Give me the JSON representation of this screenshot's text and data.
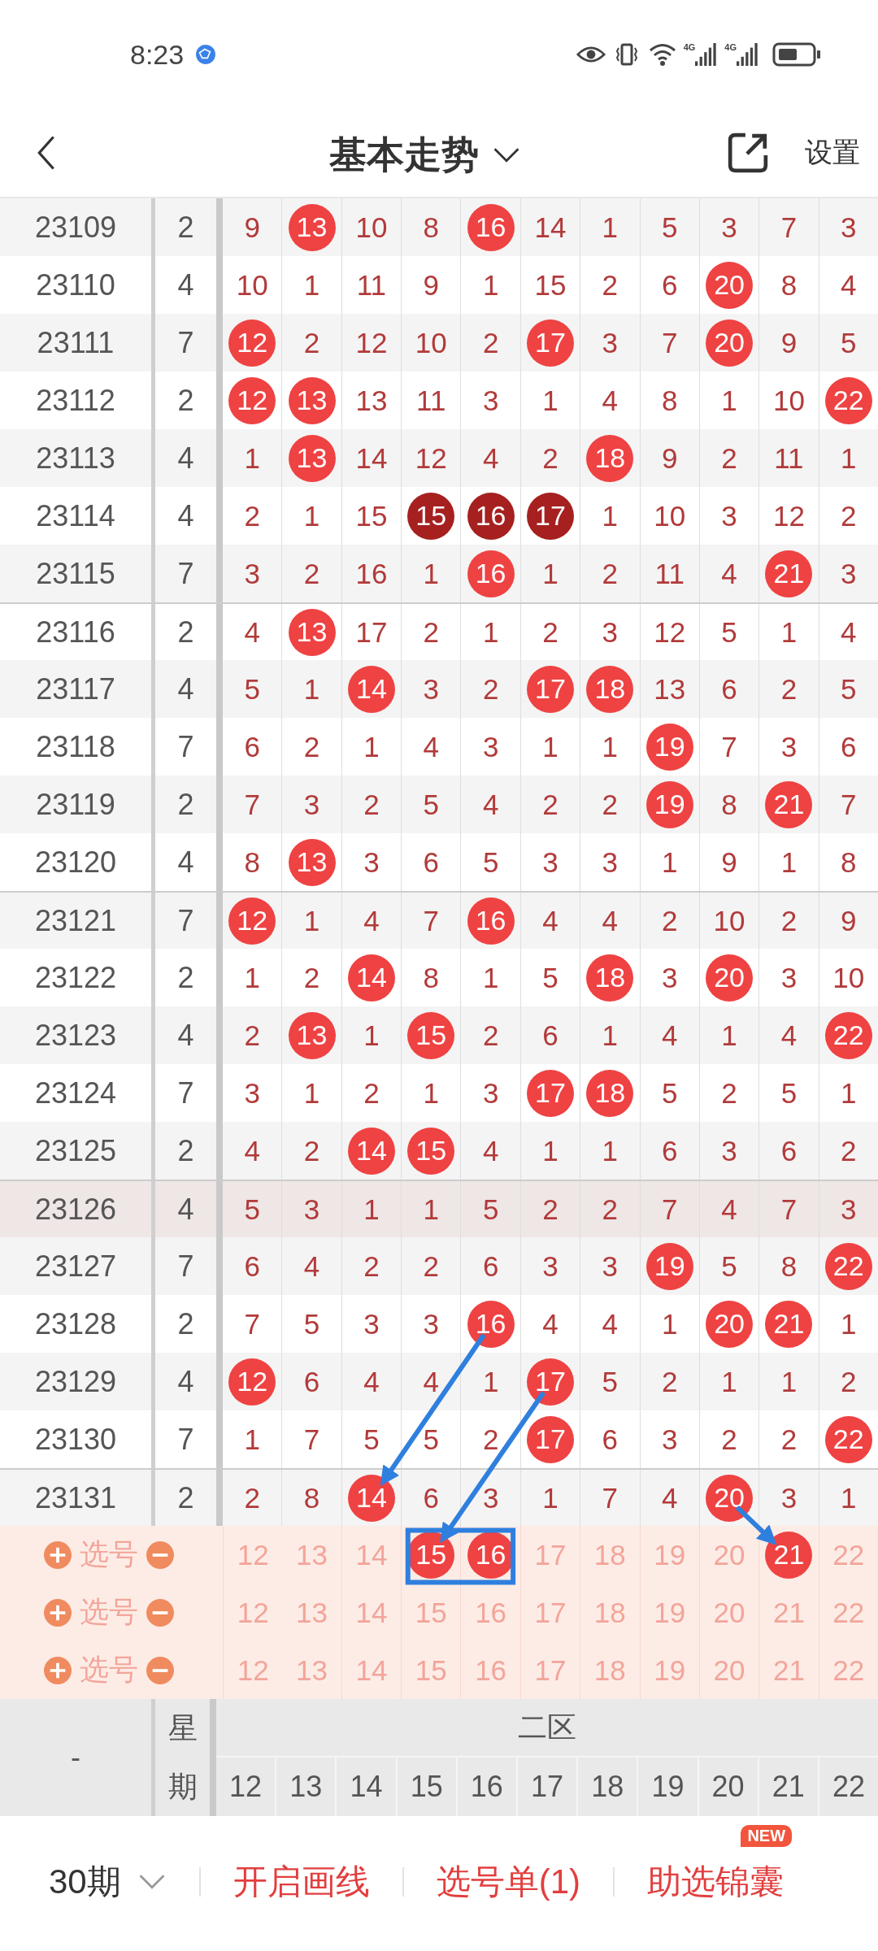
{
  "status_bar": {
    "time": "8:23",
    "signals": [
      {
        "label": "4G"
      },
      {
        "label": "4G"
      }
    ]
  },
  "header": {
    "title": "基本走势",
    "settings": "设置"
  },
  "rows": [
    {
      "period": "23109",
      "weekday": "2",
      "highlighted": false,
      "cells": [
        {
          "value": "9",
          "kind": "plain"
        },
        {
          "value": "13",
          "kind": "ball"
        },
        {
          "value": "10",
          "kind": "plain"
        },
        {
          "value": "8",
          "kind": "plain"
        },
        {
          "value": "16",
          "kind": "ball"
        },
        {
          "value": "14",
          "kind": "plain"
        },
        {
          "value": "1",
          "kind": "plain"
        },
        {
          "value": "5",
          "kind": "plain"
        },
        {
          "value": "3",
          "kind": "plain"
        },
        {
          "value": "7",
          "kind": "plain"
        },
        {
          "value": "3",
          "kind": "plain"
        }
      ]
    },
    {
      "period": "23110",
      "weekday": "4",
      "highlighted": false,
      "cells": [
        {
          "value": "10",
          "kind": "plain"
        },
        {
          "value": "1",
          "kind": "plain"
        },
        {
          "value": "11",
          "kind": "plain"
        },
        {
          "value": "9",
          "kind": "plain"
        },
        {
          "value": "1",
          "kind": "plain"
        },
        {
          "value": "15",
          "kind": "plain"
        },
        {
          "value": "2",
          "kind": "plain"
        },
        {
          "value": "6",
          "kind": "plain"
        },
        {
          "value": "20",
          "kind": "ball"
        },
        {
          "value": "8",
          "kind": "plain"
        },
        {
          "value": "4",
          "kind": "plain"
        }
      ]
    },
    {
      "period": "23111",
      "weekday": "7",
      "highlighted": false,
      "cells": [
        {
          "value": "12",
          "kind": "ball"
        },
        {
          "value": "2",
          "kind": "plain"
        },
        {
          "value": "12",
          "kind": "plain"
        },
        {
          "value": "10",
          "kind": "plain"
        },
        {
          "value": "2",
          "kind": "plain"
        },
        {
          "value": "17",
          "kind": "ball"
        },
        {
          "value": "3",
          "kind": "plain"
        },
        {
          "value": "7",
          "kind": "plain"
        },
        {
          "value": "20",
          "kind": "ball"
        },
        {
          "value": "9",
          "kind": "plain"
        },
        {
          "value": "5",
          "kind": "plain"
        }
      ]
    },
    {
      "period": "23112",
      "weekday": "2",
      "highlighted": false,
      "cells": [
        {
          "value": "12",
          "kind": "ball"
        },
        {
          "value": "13",
          "kind": "ball"
        },
        {
          "value": "13",
          "kind": "plain"
        },
        {
          "value": "11",
          "kind": "plain"
        },
        {
          "value": "3",
          "kind": "plain"
        },
        {
          "value": "1",
          "kind": "plain"
        },
        {
          "value": "4",
          "kind": "plain"
        },
        {
          "value": "8",
          "kind": "plain"
        },
        {
          "value": "1",
          "kind": "plain"
        },
        {
          "value": "10",
          "kind": "plain"
        },
        {
          "value": "22",
          "kind": "ball"
        }
      ]
    },
    {
      "period": "23113",
      "weekday": "4",
      "highlighted": false,
      "cells": [
        {
          "value": "1",
          "kind": "plain"
        },
        {
          "value": "13",
          "kind": "ball"
        },
        {
          "value": "14",
          "kind": "plain"
        },
        {
          "value": "12",
          "kind": "plain"
        },
        {
          "value": "4",
          "kind": "plain"
        },
        {
          "value": "2",
          "kind": "plain"
        },
        {
          "value": "18",
          "kind": "ball"
        },
        {
          "value": "9",
          "kind": "plain"
        },
        {
          "value": "2",
          "kind": "plain"
        },
        {
          "value": "11",
          "kind": "plain"
        },
        {
          "value": "1",
          "kind": "plain"
        }
      ]
    },
    {
      "period": "23114",
      "weekday": "4",
      "highlighted": false,
      "cells": [
        {
          "value": "2",
          "kind": "plain"
        },
        {
          "value": "1",
          "kind": "plain"
        },
        {
          "value": "15",
          "kind": "plain"
        },
        {
          "value": "15",
          "kind": "dark"
        },
        {
          "value": "16",
          "kind": "dark"
        },
        {
          "value": "17",
          "kind": "dark"
        },
        {
          "value": "1",
          "kind": "plain"
        },
        {
          "value": "10",
          "kind": "plain"
        },
        {
          "value": "3",
          "kind": "plain"
        },
        {
          "value": "12",
          "kind": "plain"
        },
        {
          "value": "2",
          "kind": "plain"
        }
      ]
    },
    {
      "period": "23115",
      "weekday": "7",
      "highlighted": false,
      "cells": [
        {
          "value": "3",
          "kind": "plain"
        },
        {
          "value": "2",
          "kind": "plain"
        },
        {
          "value": "16",
          "kind": "plain"
        },
        {
          "value": "1",
          "kind": "plain"
        },
        {
          "value": "16",
          "kind": "ball"
        },
        {
          "value": "1",
          "kind": "plain"
        },
        {
          "value": "2",
          "kind": "plain"
        },
        {
          "value": "11",
          "kind": "plain"
        },
        {
          "value": "4",
          "kind": "plain"
        },
        {
          "value": "21",
          "kind": "ball"
        },
        {
          "value": "3",
          "kind": "plain"
        }
      ]
    },
    {
      "period": "23116",
      "weekday": "2",
      "highlighted": false,
      "cells": [
        {
          "value": "4",
          "kind": "plain"
        },
        {
          "value": "13",
          "kind": "ball"
        },
        {
          "value": "17",
          "kind": "plain"
        },
        {
          "value": "2",
          "kind": "plain"
        },
        {
          "value": "1",
          "kind": "plain"
        },
        {
          "value": "2",
          "kind": "plain"
        },
        {
          "value": "3",
          "kind": "plain"
        },
        {
          "value": "12",
          "kind": "plain"
        },
        {
          "value": "5",
          "kind": "plain"
        },
        {
          "value": "1",
          "kind": "plain"
        },
        {
          "value": "4",
          "kind": "plain"
        }
      ]
    },
    {
      "period": "23117",
      "weekday": "4",
      "highlighted": false,
      "cells": [
        {
          "value": "5",
          "kind": "plain"
        },
        {
          "value": "1",
          "kind": "plain"
        },
        {
          "value": "14",
          "kind": "ball"
        },
        {
          "value": "3",
          "kind": "plain"
        },
        {
          "value": "2",
          "kind": "plain"
        },
        {
          "value": "17",
          "kind": "ball"
        },
        {
          "value": "18",
          "kind": "ball"
        },
        {
          "value": "13",
          "kind": "plain"
        },
        {
          "value": "6",
          "kind": "plain"
        },
        {
          "value": "2",
          "kind": "plain"
        },
        {
          "value": "5",
          "kind": "plain"
        }
      ]
    },
    {
      "period": "23118",
      "weekday": "7",
      "highlighted": false,
      "cells": [
        {
          "value": "6",
          "kind": "plain"
        },
        {
          "value": "2",
          "kind": "plain"
        },
        {
          "value": "1",
          "kind": "plain"
        },
        {
          "value": "4",
          "kind": "plain"
        },
        {
          "value": "3",
          "kind": "plain"
        },
        {
          "value": "1",
          "kind": "plain"
        },
        {
          "value": "1",
          "kind": "plain"
        },
        {
          "value": "19",
          "kind": "ball"
        },
        {
          "value": "7",
          "kind": "plain"
        },
        {
          "value": "3",
          "kind": "plain"
        },
        {
          "value": "6",
          "kind": "plain"
        }
      ]
    },
    {
      "period": "23119",
      "weekday": "2",
      "highlighted": false,
      "cells": [
        {
          "value": "7",
          "kind": "plain"
        },
        {
          "value": "3",
          "kind": "plain"
        },
        {
          "value": "2",
          "kind": "plain"
        },
        {
          "value": "5",
          "kind": "plain"
        },
        {
          "value": "4",
          "kind": "plain"
        },
        {
          "value": "2",
          "kind": "plain"
        },
        {
          "value": "2",
          "kind": "plain"
        },
        {
          "value": "19",
          "kind": "ball"
        },
        {
          "value": "8",
          "kind": "plain"
        },
        {
          "value": "21",
          "kind": "ball"
        },
        {
          "value": "7",
          "kind": "plain"
        }
      ]
    },
    {
      "period": "23120",
      "weekday": "4",
      "highlighted": false,
      "cells": [
        {
          "value": "8",
          "kind": "plain"
        },
        {
          "value": "13",
          "kind": "ball"
        },
        {
          "value": "3",
          "kind": "plain"
        },
        {
          "value": "6",
          "kind": "plain"
        },
        {
          "value": "5",
          "kind": "plain"
        },
        {
          "value": "3",
          "kind": "plain"
        },
        {
          "value": "3",
          "kind": "plain"
        },
        {
          "value": "1",
          "kind": "plain"
        },
        {
          "value": "9",
          "kind": "plain"
        },
        {
          "value": "1",
          "kind": "plain"
        },
        {
          "value": "8",
          "kind": "plain"
        }
      ]
    },
    {
      "period": "23121",
      "weekday": "7",
      "highlighted": false,
      "cells": [
        {
          "value": "12",
          "kind": "ball"
        },
        {
          "value": "1",
          "kind": "plain"
        },
        {
          "value": "4",
          "kind": "plain"
        },
        {
          "value": "7",
          "kind": "plain"
        },
        {
          "value": "16",
          "kind": "ball"
        },
        {
          "value": "4",
          "kind": "plain"
        },
        {
          "value": "4",
          "kind": "plain"
        },
        {
          "value": "2",
          "kind": "plain"
        },
        {
          "value": "10",
          "kind": "plain"
        },
        {
          "value": "2",
          "kind": "plain"
        },
        {
          "value": "9",
          "kind": "plain"
        }
      ]
    },
    {
      "period": "23122",
      "weekday": "2",
      "highlighted": false,
      "cells": [
        {
          "value": "1",
          "kind": "plain"
        },
        {
          "value": "2",
          "kind": "plain"
        },
        {
          "value": "14",
          "kind": "ball"
        },
        {
          "value": "8",
          "kind": "plain"
        },
        {
          "value": "1",
          "kind": "plain"
        },
        {
          "value": "5",
          "kind": "plain"
        },
        {
          "value": "18",
          "kind": "ball"
        },
        {
          "value": "3",
          "kind": "plain"
        },
        {
          "value": "20",
          "kind": "ball"
        },
        {
          "value": "3",
          "kind": "plain"
        },
        {
          "value": "10",
          "kind": "plain"
        }
      ]
    },
    {
      "period": "23123",
      "weekday": "4",
      "highlighted": false,
      "cells": [
        {
          "value": "2",
          "kind": "plain"
        },
        {
          "value": "13",
          "kind": "ball"
        },
        {
          "value": "1",
          "kind": "plain"
        },
        {
          "value": "15",
          "kind": "ball"
        },
        {
          "value": "2",
          "kind": "plain"
        },
        {
          "value": "6",
          "kind": "plain"
        },
        {
          "value": "1",
          "kind": "plain"
        },
        {
          "value": "4",
          "kind": "plain"
        },
        {
          "value": "1",
          "kind": "plain"
        },
        {
          "value": "4",
          "kind": "plain"
        },
        {
          "value": "22",
          "kind": "ball"
        }
      ]
    },
    {
      "period": "23124",
      "weekday": "7",
      "highlighted": false,
      "cells": [
        {
          "value": "3",
          "kind": "plain"
        },
        {
          "value": "1",
          "kind": "plain"
        },
        {
          "value": "2",
          "kind": "plain"
        },
        {
          "value": "1",
          "kind": "plain"
        },
        {
          "value": "3",
          "kind": "plain"
        },
        {
          "value": "17",
          "kind": "ball"
        },
        {
          "value": "18",
          "kind": "ball"
        },
        {
          "value": "5",
          "kind": "plain"
        },
        {
          "value": "2",
          "kind": "plain"
        },
        {
          "value": "5",
          "kind": "plain"
        },
        {
          "value": "1",
          "kind": "plain"
        }
      ]
    },
    {
      "period": "23125",
      "weekday": "2",
      "highlighted": false,
      "cells": [
        {
          "value": "4",
          "kind": "plain"
        },
        {
          "value": "2",
          "kind": "plain"
        },
        {
          "value": "14",
          "kind": "ball"
        },
        {
          "value": "15",
          "kind": "ball"
        },
        {
          "value": "4",
          "kind": "plain"
        },
        {
          "value": "1",
          "kind": "plain"
        },
        {
          "value": "1",
          "kind": "plain"
        },
        {
          "value": "6",
          "kind": "plain"
        },
        {
          "value": "3",
          "kind": "plain"
        },
        {
          "value": "6",
          "kind": "plain"
        },
        {
          "value": "2",
          "kind": "plain"
        }
      ]
    },
    {
      "period": "23126",
      "weekday": "4",
      "highlighted": true,
      "cells": [
        {
          "value": "5",
          "kind": "plain"
        },
        {
          "value": "3",
          "kind": "plain"
        },
        {
          "value": "1",
          "kind": "plain"
        },
        {
          "value": "1",
          "kind": "plain"
        },
        {
          "value": "5",
          "kind": "plain"
        },
        {
          "value": "2",
          "kind": "plain"
        },
        {
          "value": "2",
          "kind": "plain"
        },
        {
          "value": "7",
          "kind": "plain"
        },
        {
          "value": "4",
          "kind": "plain"
        },
        {
          "value": "7",
          "kind": "plain"
        },
        {
          "value": "3",
          "kind": "plain"
        }
      ]
    },
    {
      "period": "23127",
      "weekday": "7",
      "highlighted": false,
      "cells": [
        {
          "value": "6",
          "kind": "plain"
        },
        {
          "value": "4",
          "kind": "plain"
        },
        {
          "value": "2",
          "kind": "plain"
        },
        {
          "value": "2",
          "kind": "plain"
        },
        {
          "value": "6",
          "kind": "plain"
        },
        {
          "value": "3",
          "kind": "plain"
        },
        {
          "value": "3",
          "kind": "plain"
        },
        {
          "value": "19",
          "kind": "ball"
        },
        {
          "value": "5",
          "kind": "plain"
        },
        {
          "value": "8",
          "kind": "plain"
        },
        {
          "value": "22",
          "kind": "ball"
        }
      ]
    },
    {
      "period": "23128",
      "weekday": "2",
      "highlighted": false,
      "cells": [
        {
          "value": "7",
          "kind": "plain"
        },
        {
          "value": "5",
          "kind": "plain"
        },
        {
          "value": "3",
          "kind": "plain"
        },
        {
          "value": "3",
          "kind": "plain"
        },
        {
          "value": "16",
          "kind": "ball",
          "arrow_start": true
        },
        {
          "value": "4",
          "kind": "plain"
        },
        {
          "value": "4",
          "kind": "plain"
        },
        {
          "value": "1",
          "kind": "plain"
        },
        {
          "value": "20",
          "kind": "ball"
        },
        {
          "value": "21",
          "kind": "ball"
        },
        {
          "value": "1",
          "kind": "plain"
        }
      ]
    },
    {
      "period": "23129",
      "weekday": "4",
      "highlighted": false,
      "cells": [
        {
          "value": "12",
          "kind": "ball"
        },
        {
          "value": "6",
          "kind": "plain"
        },
        {
          "value": "4",
          "kind": "plain"
        },
        {
          "value": "4",
          "kind": "plain"
        },
        {
          "value": "1",
          "kind": "plain"
        },
        {
          "value": "17",
          "kind": "ball",
          "arrow_start": true
        },
        {
          "value": "5",
          "kind": "plain"
        },
        {
          "value": "2",
          "kind": "plain"
        },
        {
          "value": "1",
          "kind": "plain"
        },
        {
          "value": "1",
          "kind": "plain"
        },
        {
          "value": "2",
          "kind": "plain"
        }
      ]
    },
    {
      "period": "23130",
      "weekday": "7",
      "highlighted": false,
      "cells": [
        {
          "value": "1",
          "kind": "plain"
        },
        {
          "value": "7",
          "kind": "plain"
        },
        {
          "value": "5",
          "kind": "plain"
        },
        {
          "value": "5",
          "kind": "plain"
        },
        {
          "value": "2",
          "kind": "plain"
        },
        {
          "value": "17",
          "kind": "ball"
        },
        {
          "value": "6",
          "kind": "plain"
        },
        {
          "value": "3",
          "kind": "plain"
        },
        {
          "value": "2",
          "kind": "plain"
        },
        {
          "value": "2",
          "kind": "plain"
        },
        {
          "value": "22",
          "kind": "ball"
        }
      ]
    },
    {
      "period": "23131",
      "weekday": "2",
      "highlighted": false,
      "cells": [
        {
          "value": "2",
          "kind": "plain"
        },
        {
          "value": "8",
          "kind": "plain"
        },
        {
          "value": "14",
          "kind": "ball",
          "arrow_end": true
        },
        {
          "value": "6",
          "kind": "plain"
        },
        {
          "value": "3",
          "kind": "plain"
        },
        {
          "value": "1",
          "kind": "plain"
        },
        {
          "value": "7",
          "kind": "plain"
        },
        {
          "value": "4",
          "kind": "plain"
        },
        {
          "value": "20",
          "kind": "ball",
          "arrow_start": true
        },
        {
          "value": "3",
          "kind": "plain"
        },
        {
          "value": "1",
          "kind": "plain"
        }
      ]
    }
  ],
  "pick_rows": [
    {
      "label": "选号",
      "numbers": [
        {
          "value": "12",
          "selected": false
        },
        {
          "value": "13",
          "selected": false
        },
        {
          "value": "14",
          "selected": false
        },
        {
          "value": "15",
          "selected": true,
          "arrow_end": true,
          "framed": true
        },
        {
          "value": "16",
          "selected": true,
          "framed": true
        },
        {
          "value": "17",
          "selected": false
        },
        {
          "value": "18",
          "selected": false
        },
        {
          "value": "19",
          "selected": false
        },
        {
          "value": "20",
          "selected": false
        },
        {
          "value": "21",
          "selected": true,
          "arrow_end": true
        },
        {
          "value": "22",
          "selected": false
        }
      ]
    },
    {
      "label": "选号",
      "numbers": [
        {
          "value": "12",
          "selected": false
        },
        {
          "value": "13",
          "selected": false
        },
        {
          "value": "14",
          "selected": false
        },
        {
          "value": "15",
          "selected": false
        },
        {
          "value": "16",
          "selected": false
        },
        {
          "value": "17",
          "selected": false
        },
        {
          "value": "18",
          "selected": false
        },
        {
          "value": "19",
          "selected": false
        },
        {
          "value": "20",
          "selected": false
        },
        {
          "value": "21",
          "selected": false
        },
        {
          "value": "22",
          "selected": false
        }
      ]
    },
    {
      "label": "选号",
      "numbers": [
        {
          "value": "12",
          "selected": false
        },
        {
          "value": "13",
          "selected": false
        },
        {
          "value": "14",
          "selected": false
        },
        {
          "value": "15",
          "selected": false
        },
        {
          "value": "16",
          "selected": false
        },
        {
          "value": "17",
          "selected": false
        },
        {
          "value": "18",
          "selected": false
        },
        {
          "value": "19",
          "selected": false
        },
        {
          "value": "20",
          "selected": false
        },
        {
          "value": "21",
          "selected": false
        },
        {
          "value": "22",
          "selected": false
        }
      ]
    }
  ],
  "legend": {
    "period_header": "-",
    "weekday_header": "星期",
    "zone_label": "二区",
    "numbers": [
      "12",
      "13",
      "14",
      "15",
      "16",
      "17",
      "18",
      "19",
      "20",
      "21",
      "22"
    ]
  },
  "bottom_bar": {
    "periods": "30期",
    "actions": [
      {
        "label": "开启画线"
      },
      {
        "label": "选号单(1)"
      },
      {
        "label": "助选锦囊",
        "badge": "NEW"
      }
    ]
  }
}
